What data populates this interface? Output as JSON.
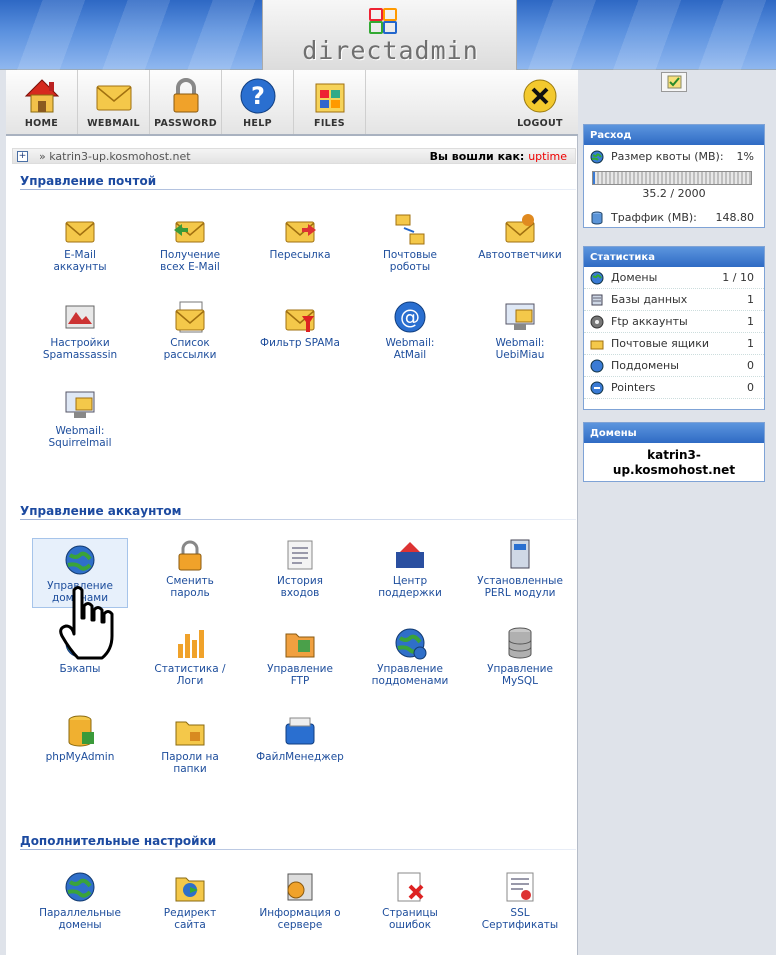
{
  "header": {
    "logo_text": "directadmin"
  },
  "toolbar": {
    "items": [
      {
        "label": "HOME",
        "icon": "home-icon"
      },
      {
        "label": "WEBMAIL",
        "icon": "webmail-icon"
      },
      {
        "label": "PASSWORD",
        "icon": "lock-icon"
      },
      {
        "label": "HELP",
        "icon": "help-icon"
      },
      {
        "label": "FILES",
        "icon": "files-icon"
      },
      {
        "label": "LOGOUT",
        "icon": "logout-icon"
      }
    ]
  },
  "breadcrumb": {
    "path": "» katrin3-up.kosmohost.net",
    "logged_in_label": "Вы вошли как:",
    "user": "uptime"
  },
  "sections": {
    "mail": {
      "title": "Управление почтой",
      "items": [
        {
          "label": "E-Mail\nаккаунты",
          "icon": "envelope-icon"
        },
        {
          "label": "Получение\nвсех E-Mail",
          "icon": "fetch-mail-icon"
        },
        {
          "label": "Пересылка",
          "icon": "forward-mail-icon"
        },
        {
          "label": "Почтовые\nроботы",
          "icon": "mail-robots-icon"
        },
        {
          "label": "Автоответчики",
          "icon": "autoresponder-icon"
        },
        {
          "label": "Настройки\nSpamassassin",
          "icon": "spamassassin-icon"
        },
        {
          "label": "Список\nрассылки",
          "icon": "mailing-list-icon"
        },
        {
          "label": "Фильтр SPAMа",
          "icon": "spam-filter-icon"
        },
        {
          "label": "Webmail:\nAtMail",
          "icon": "at-sign-icon"
        },
        {
          "label": "Webmail:\nUebiMiau",
          "icon": "monitor-mail-icon"
        },
        {
          "label": "Webmail:\nSquirrelmail",
          "icon": "monitor-mail-icon"
        }
      ]
    },
    "account": {
      "title": "Управление аккаунтом",
      "items": [
        {
          "label": "Управление\nдоменами",
          "icon": "globe-icon"
        },
        {
          "label": "Сменить\nпароль",
          "icon": "padlock-icon"
        },
        {
          "label": "История\nвходов",
          "icon": "log-icon"
        },
        {
          "label": "Центр\nподдержки",
          "icon": "support-icon"
        },
        {
          "label": "Установленные\nPERL модули",
          "icon": "perl-modules-icon"
        },
        {
          "label": "Бэкапы",
          "icon": "backup-icon"
        },
        {
          "label": "Статистика /\nЛоги",
          "icon": "stats-chart-icon"
        },
        {
          "label": "Управление\nFTP",
          "icon": "ftp-folder-icon"
        },
        {
          "label": "Управление\nподдоменами",
          "icon": "subdomain-globe-icon"
        },
        {
          "label": "Управление\nMySQL",
          "icon": "database-icon"
        },
        {
          "label": "phpMyAdmin",
          "icon": "phpmyadmin-icon"
        },
        {
          "label": "Пароли на\nпапки",
          "icon": "folder-lock-icon"
        },
        {
          "label": "ФайлМенеджер",
          "icon": "file-manager-icon"
        }
      ]
    },
    "extra": {
      "title": "Дополнительные настройки",
      "items": [
        {
          "label": "Параллельные\nдомены",
          "icon": "globe-icon"
        },
        {
          "label": "Редирект\nсайта",
          "icon": "redirect-icon"
        },
        {
          "label": "Информация о\nсервере",
          "icon": "server-info-icon"
        },
        {
          "label": "Страницы\nошибок",
          "icon": "error-page-icon"
        },
        {
          "label": "SSL\nСертификаты",
          "icon": "certificate-icon"
        }
      ]
    }
  },
  "sidebar": {
    "usage": {
      "title": "Расход",
      "quota_label": "Размер квоты (MB):",
      "quota_percent": "1%",
      "quota_progress": 0.01,
      "quota_value": "35.2 / 2000",
      "traffic_label": "Траффик (MB):",
      "traffic_value": "148.80"
    },
    "stats": {
      "title": "Статистика",
      "rows": [
        {
          "label": "Домены",
          "value": "1 / 10",
          "icon": "globe-icon"
        },
        {
          "label": "Базы данных",
          "value": "1",
          "icon": "database-icon"
        },
        {
          "label": "Ftp аккаунты",
          "value": "1",
          "icon": "ftp-icon"
        },
        {
          "label": "Почтовые ящики",
          "value": "1",
          "icon": "mailbox-icon"
        },
        {
          "label": "Поддомены",
          "value": "0",
          "icon": "subdomain-icon"
        },
        {
          "label": "Pointers",
          "value": "0",
          "icon": "pointer-icon"
        }
      ]
    },
    "domains": {
      "title": "Домены",
      "domain": "katrin3-\nup.kosmohost.net"
    }
  },
  "colors": {
    "accent": "#2f6bc4",
    "link": "#1d4d9c",
    "user": "#e00000"
  }
}
